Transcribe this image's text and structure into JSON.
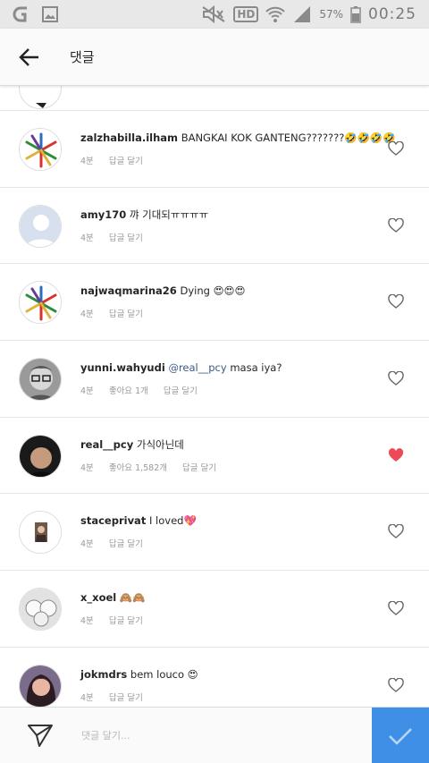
{
  "status_bar": {
    "left_icons": [
      "carrier-logo-icon",
      "gallery-icon"
    ],
    "hd_label": "HD",
    "battery": "57%",
    "time": "00:25"
  },
  "header": {
    "title": "댓글"
  },
  "comments": [
    {
      "username": "zalzhabilla.ilham",
      "mention": "",
      "text": "BANGKAI KOK GANTENG???????🤣🤣🤣🤣",
      "time": "4분",
      "likes": "",
      "reply": "답글 달기",
      "liked": false,
      "avatar": "exo-logo"
    },
    {
      "username": "amy170",
      "mention": "",
      "text": "꺄 기대되ㅠㅠㅠㅠ",
      "time": "4분",
      "likes": "",
      "reply": "답글 달기",
      "liked": false,
      "avatar": "default"
    },
    {
      "username": "najwaqmarina26",
      "mention": "",
      "text": "Dying 😍😍😍",
      "time": "4분",
      "likes": "",
      "reply": "답글 달기",
      "liked": false,
      "avatar": "exo-logo"
    },
    {
      "username": "yunni.wahyudi",
      "mention": "@real__pcy",
      "text": "masa iya?",
      "time": "4분",
      "likes": "좋아요 1개",
      "reply": "답글 달기",
      "liked": false,
      "avatar": "photo-man-glasses"
    },
    {
      "username": "real__pcy",
      "mention": "",
      "text": "가식아닌데",
      "time": "4분",
      "likes": "좋아요 1,582개",
      "reply": "답글 달기",
      "liked": true,
      "avatar": "photo-man-dark"
    },
    {
      "username": "staceprivat",
      "mention": "",
      "text": "I loved💖",
      "time": "4분",
      "likes": "",
      "reply": "답글 달기",
      "liked": false,
      "avatar": "photo-woman"
    },
    {
      "username": "x_xoel",
      "mention": "",
      "text": "🙈🙈",
      "time": "4분",
      "likes": "",
      "reply": "답글 달기",
      "liked": false,
      "avatar": "photo-sketch"
    },
    {
      "username": "jokmdrs",
      "mention": "",
      "text": "bem louco 😍",
      "time": "4분",
      "likes": "",
      "reply": "답글 달기",
      "liked": false,
      "avatar": "photo-girl"
    }
  ],
  "composer": {
    "placeholder": "댓글 달기..."
  },
  "colors": {
    "accent": "#3f8fe6",
    "liked_heart": "#ed4956",
    "mention": "#3b5b88"
  }
}
